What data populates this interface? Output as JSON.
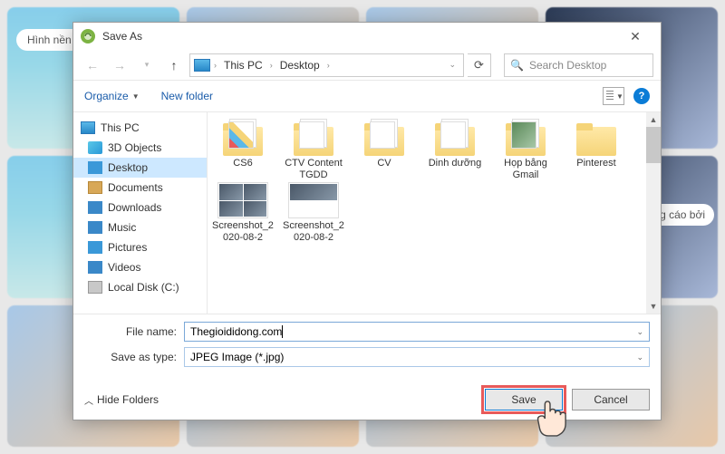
{
  "bg": {
    "tag1": "Hình nền",
    "tag2": "ảng cáo bởi"
  },
  "dialog": {
    "title": "Save As",
    "nav": {
      "crumbs": [
        "This PC",
        "Desktop"
      ],
      "search_placeholder": "Search Desktop"
    },
    "toolbar": {
      "organize": "Organize",
      "new_folder": "New folder"
    },
    "tree": {
      "root": "This PC",
      "items": [
        "3D Objects",
        "Desktop",
        "Documents",
        "Downloads",
        "Music",
        "Pictures",
        "Videos",
        "Local Disk (C:)"
      ]
    },
    "files": [
      {
        "name": "CS6",
        "type": "folder",
        "preview": "color"
      },
      {
        "name": "CTV Content TGDD",
        "type": "folder",
        "preview": "doc"
      },
      {
        "name": "CV",
        "type": "folder",
        "preview": "doc"
      },
      {
        "name": "Dinh dưỡng",
        "type": "folder",
        "preview": "doc"
      },
      {
        "name": "Họp bằng Gmail",
        "type": "folder",
        "preview": "img"
      },
      {
        "name": "Pinterest",
        "type": "folder"
      },
      {
        "name": "Screenshot_2020-08-2",
        "type": "image"
      },
      {
        "name": "Screenshot_2020-08-2",
        "type": "image"
      }
    ],
    "form": {
      "filename_label": "File name:",
      "filename_value": "Thegioididong.com",
      "type_label": "Save as type:",
      "type_value": "JPEG Image (*.jpg)"
    },
    "footer": {
      "hide_folders": "Hide Folders",
      "save": "Save",
      "cancel": "Cancel"
    }
  }
}
